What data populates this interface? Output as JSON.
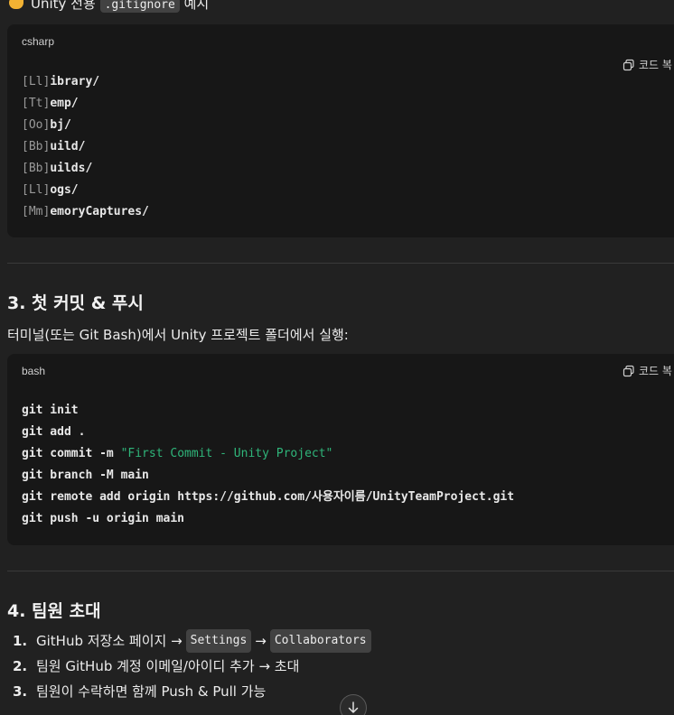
{
  "intro": {
    "prefix": "Unity 전용",
    "code": ".gitignore",
    "suffix": "예시"
  },
  "block1": {
    "lang": "csharp",
    "copy_label": "코드 복",
    "lines": [
      {
        "b": "[Ll]",
        "t": "ibrary/"
      },
      {
        "b": "[Tt]",
        "t": "emp/"
      },
      {
        "b": "[Oo]",
        "t": "bj/"
      },
      {
        "b": "[Bb]",
        "t": "uild/"
      },
      {
        "b": "[Bb]",
        "t": "uilds/"
      },
      {
        "b": "[Ll]",
        "t": "ogs/"
      },
      {
        "b": "[Mm]",
        "t": "emoryCaptures/"
      }
    ]
  },
  "section3": {
    "title": "3. 첫 커밋 & 푸시",
    "desc": "터미널(또는 Git Bash)에서 Unity 프로젝트 폴더에서 실행:"
  },
  "block2": {
    "lang": "bash",
    "copy_label": "코드 복",
    "lines": {
      "l1": "git init",
      "l2": "git add .",
      "l3_cmd": "git commit -m ",
      "l3_str": "\"First Commit - Unity Project\"",
      "l4": "git branch -M main",
      "l5_cmd": "git remote add origin ",
      "l5_url": "https://github.com/사용자이름/UnityTeamProject.git",
      "l6": "git push -u origin main"
    }
  },
  "section4": {
    "title": "4. 팀원 초대",
    "items": [
      {
        "num": "1.",
        "pre": "GitHub 저장소 페이지 →",
        "code1": "Settings",
        "mid": "→",
        "code2": "Collaborators"
      },
      {
        "num": "2.",
        "text": "팀원 GitHub 계정 이메일/아이디 추가 → 초대"
      },
      {
        "num": "3.",
        "text": "팀원이 수락하면 함께 Push & Pull 가능"
      }
    ]
  },
  "icons": {
    "copy": "copy-icon",
    "scroll": "arrow-down-icon",
    "emoji": "pointing-hand-icon"
  }
}
